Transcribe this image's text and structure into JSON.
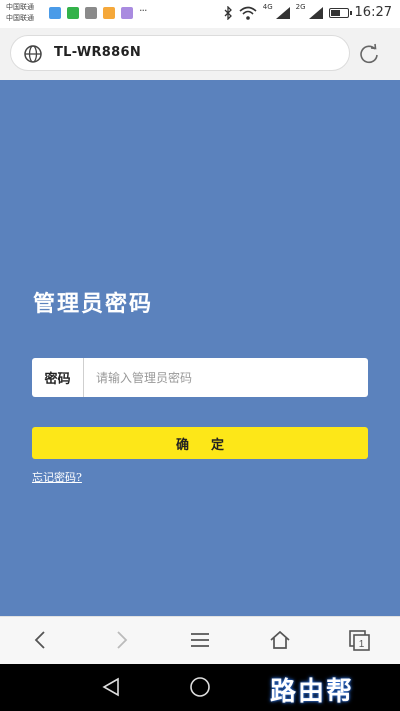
{
  "status_bar": {
    "carrier_lines": [
      "中国联通",
      "中国联通"
    ],
    "signal_tags": [
      "4G",
      "2G"
    ],
    "time": "16:27",
    "battery_level": 0.6,
    "notification_icons": [
      "message-app-icon",
      "wechat-icon",
      "gallery-icon",
      "app-icon",
      "app-icon",
      "more-icon"
    ]
  },
  "address_bar": {
    "url": "TL-WR886N"
  },
  "login": {
    "title": "管理员密码",
    "password_label": "密码",
    "password_placeholder": "请输入管理员密码",
    "confirm_label": "确定",
    "forgot_link": "忘记密码?"
  },
  "toolbar": {
    "items": [
      "back-icon",
      "forward-icon",
      "menu-icon",
      "home-icon",
      "tabs-icon"
    ],
    "tab_count": "1"
  },
  "watermark": "路由帮",
  "colors": {
    "page_background": "#5b82bd",
    "confirm_button": "#fde718",
    "watermark_glow": "#2d6cd1"
  }
}
